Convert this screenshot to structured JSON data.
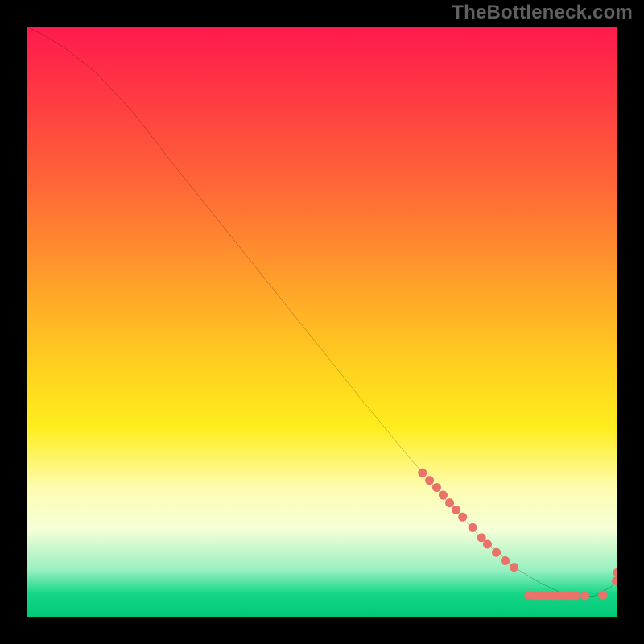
{
  "watermark": "TheBottleneck.com",
  "chart_data": {
    "type": "line",
    "title": "",
    "xlabel": "",
    "ylabel": "",
    "xlim": [
      0,
      100
    ],
    "ylim": [
      0,
      100
    ],
    "grid": false,
    "legend": false,
    "series": [
      {
        "name": "curve",
        "stroke": "#000000",
        "stroke_width": 1.3,
        "x": [
          0,
          3,
          7,
          12,
          18,
          25,
          33,
          41,
          49,
          57,
          64,
          70,
          75,
          79,
          83,
          87,
          90,
          93,
          96,
          99,
          100
        ],
        "y": [
          100,
          98.5,
          96,
          92,
          85.5,
          76.5,
          66.5,
          56.5,
          46.5,
          36.5,
          28,
          21,
          15.5,
          11.5,
          8.2,
          5.8,
          4.4,
          3.6,
          3.6,
          5.2,
          7.0
        ]
      }
    ],
    "scatter": {
      "name": "dots",
      "color": "#e9736a",
      "radius": 5,
      "points": [
        {
          "x": 67.0,
          "y": 24.5
        },
        {
          "x": 68.2,
          "y": 23.2
        },
        {
          "x": 69.4,
          "y": 22.0
        },
        {
          "x": 70.5,
          "y": 20.7
        },
        {
          "x": 71.6,
          "y": 19.4
        },
        {
          "x": 72.7,
          "y": 18.2
        },
        {
          "x": 73.8,
          "y": 17.0
        },
        {
          "x": 75.5,
          "y": 15.2
        },
        {
          "x": 77.0,
          "y": 13.5
        },
        {
          "x": 78.0,
          "y": 12.4
        },
        {
          "x": 79.5,
          "y": 11.0
        },
        {
          "x": 81.0,
          "y": 9.6
        },
        {
          "x": 82.5,
          "y": 8.5
        },
        {
          "x": 85.0,
          "y": 3.8
        },
        {
          "x": 86.0,
          "y": 3.7
        },
        {
          "x": 87.0,
          "y": 3.7
        },
        {
          "x": 88.0,
          "y": 3.7
        },
        {
          "x": 89.0,
          "y": 3.7
        },
        {
          "x": 90.0,
          "y": 3.7
        },
        {
          "x": 91.0,
          "y": 3.7
        },
        {
          "x": 92.0,
          "y": 3.7
        },
        {
          "x": 93.0,
          "y": 3.7
        },
        {
          "x": 94.5,
          "y": 3.7
        },
        {
          "x": 97.5,
          "y": 3.8
        },
        {
          "x": 99.8,
          "y": 6.2
        },
        {
          "x": 100.0,
          "y": 7.6
        }
      ]
    },
    "gradient_stops": [
      {
        "offset": 0.0,
        "color": "#ff1a4e"
      },
      {
        "offset": 0.12,
        "color": "#ff3a42"
      },
      {
        "offset": 0.28,
        "color": "#ff6a36"
      },
      {
        "offset": 0.45,
        "color": "#ffa628"
      },
      {
        "offset": 0.58,
        "color": "#ffd21e"
      },
      {
        "offset": 0.68,
        "color": "#ffee1e"
      },
      {
        "offset": 0.78,
        "color": "#fdfcb0"
      },
      {
        "offset": 0.85,
        "color": "#f6ffd7"
      },
      {
        "offset": 0.92,
        "color": "#97f0c0"
      },
      {
        "offset": 0.96,
        "color": "#14d686"
      },
      {
        "offset": 1.0,
        "color": "#00c877"
      }
    ]
  }
}
